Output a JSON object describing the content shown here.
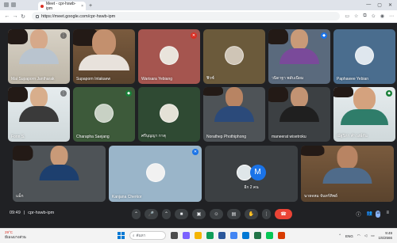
{
  "browser": {
    "tab_title": "Meet - cpr-hswb-ipm",
    "tab_close": "×",
    "new_tab": "+",
    "url": "https://meet.google.com/cpr-hswb-ipm",
    "window_controls": [
      "—",
      "▢",
      "✕"
    ]
  },
  "tiles": [
    {
      "name": "Mai Supaporn Jantharak",
      "mic": "⋮",
      "bg": "bg-room"
    },
    {
      "name": "Supaporn Intakaew",
      "mic": "",
      "bg": "bg-brown"
    },
    {
      "name": "Warisara Yebiang",
      "mic": "✕",
      "bg": "bg-rust"
    },
    {
      "name": "ฟิวซ์",
      "mic": "",
      "bg": "bg-olive"
    },
    {
      "name": "วนิดาฐา พลับเนียม",
      "mic": "◆",
      "bg": "bg-slate"
    },
    {
      "name": "Paphawee Yebian",
      "mic": "",
      "bg": "bg-blue"
    },
    {
      "name": "Fonn S.",
      "mic": "⋮",
      "bg": "bg-light"
    },
    {
      "name": "Charapha Saejang",
      "mic": "◆",
      "bg": "bg-green"
    },
    {
      "name": "ศรีบุญญา กาตุ",
      "mic": "",
      "bg": "bg-deepgreen"
    },
    {
      "name": "Norathep Phothiphong",
      "mic": "",
      "bg": "bg-grey"
    },
    {
      "name": "maneerat wisetroku",
      "mic": "",
      "bg": "bg-dark"
    },
    {
      "name": "ณัฐวิภา คำวงษ์กัน",
      "mic": "◆",
      "bg": "bg-light"
    },
    {
      "name": "แม็ก",
      "mic": "",
      "bg": "bg-grey"
    },
    {
      "name": "Kanjana Cherkor",
      "mic": "✕",
      "bg": "bg-sky"
    },
    {
      "name": "อีก 2 คน",
      "mic": "",
      "bg": "bg-dark"
    },
    {
      "name": "นายจหม จันทร์ทิพย์",
      "mic": "",
      "bg": "bg-brown"
    }
  ],
  "others_avatar_letter": "M",
  "controls": {
    "time": "09:49",
    "separator": "|",
    "meeting_code": "cpr-hswb-ipm",
    "buttons": [
      "⌃",
      "🎤",
      "⌃",
      "■",
      "▣",
      "☺",
      "▤",
      "✋",
      "⋮",
      "☎"
    ],
    "right": [
      "ⓘ",
      "👥",
      "≡"
    ],
    "participants_badge": "18"
  },
  "taskbar": {
    "temperature": "29°C",
    "weather_text": "มีเมฆบางส่วน",
    "search_placeholder": "ค้นหา",
    "time": "9:49",
    "date": "1/6/2566",
    "lang": "ENG"
  }
}
